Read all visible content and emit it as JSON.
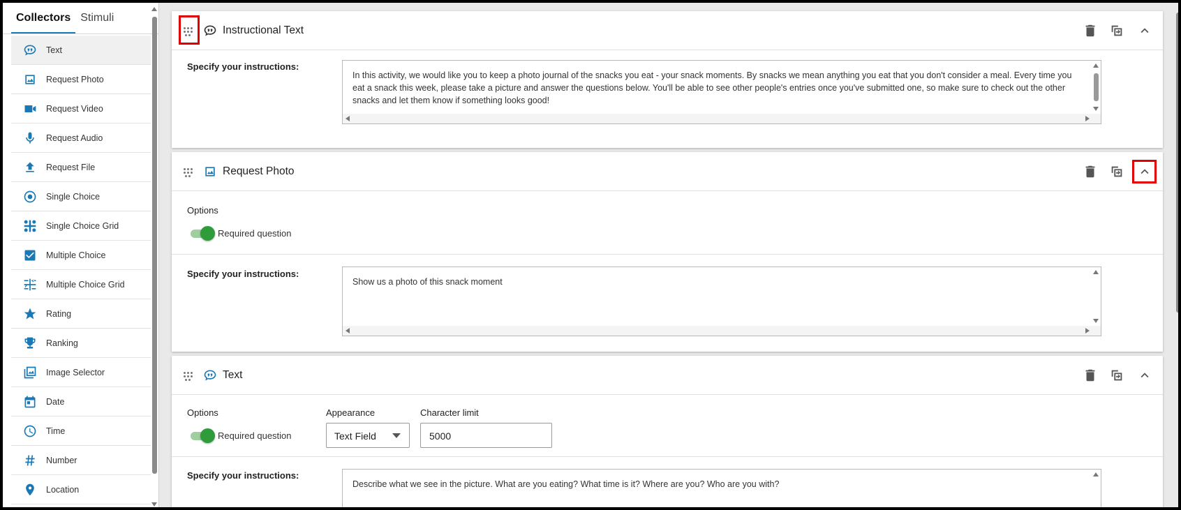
{
  "sidebar": {
    "tabs": [
      {
        "label": "Collectors",
        "active": true
      },
      {
        "label": "Stimuli",
        "active": false
      }
    ],
    "items": [
      {
        "label": "Text",
        "icon": "quote-bubble-icon"
      },
      {
        "label": "Request Photo",
        "icon": "photo-icon"
      },
      {
        "label": "Request Video",
        "icon": "video-camera-icon"
      },
      {
        "label": "Request Audio",
        "icon": "microphone-icon"
      },
      {
        "label": "Request File",
        "icon": "upload-icon"
      },
      {
        "label": "Single Choice",
        "icon": "radio-icon"
      },
      {
        "label": "Single Choice Grid",
        "icon": "grid-icon"
      },
      {
        "label": "Multiple Choice",
        "icon": "checkbox-icon"
      },
      {
        "label": "Multiple Choice Grid",
        "icon": "multi-grid-icon"
      },
      {
        "label": "Rating",
        "icon": "star-icon"
      },
      {
        "label": "Ranking",
        "icon": "trophy-icon"
      },
      {
        "label": "Image Selector",
        "icon": "images-icon"
      },
      {
        "label": "Date",
        "icon": "calendar-icon"
      },
      {
        "label": "Time",
        "icon": "clock-icon"
      },
      {
        "label": "Number",
        "icon": "hash-icon"
      },
      {
        "label": "Location",
        "icon": "location-pin-icon"
      }
    ]
  },
  "cards": {
    "instructional": {
      "title": "Instructional Text",
      "icon": "quote-bubble-icon",
      "instructions_label": "Specify your instructions:",
      "instructions_value": "In this activity, we would like you to keep a photo journal of the snacks you eat - your snack moments. By snacks we mean anything you eat that you don't consider a meal. Every time you eat a snack this week, please take a picture and answer the questions below. You'll be able to see other people's entries once you've submitted one, so make sure to check out the other snacks and let them know if something looks good!"
    },
    "photo": {
      "title": "Request Photo",
      "icon": "photo-icon",
      "options_label": "Options",
      "required_label": "Required question",
      "required": true,
      "instructions_label": "Specify your instructions:",
      "instructions_value": "Show us a photo of this snack moment"
    },
    "text": {
      "title": "Text",
      "icon": "quote-bubble-icon",
      "options_label": "Options",
      "required_label": "Required question",
      "required": true,
      "appearance_label": "Appearance",
      "appearance_value": "Text Field",
      "char_limit_label": "Character limit",
      "char_limit_value": "5000",
      "instructions_label": "Specify your instructions:",
      "instructions_value": "Describe what we see in the picture. What are you eating? What time is it? Where are you? Who are you with?"
    }
  },
  "colors": {
    "accent": "#1a79b5",
    "toggle_on": "#2e9c3b",
    "highlight": "#e00000"
  }
}
